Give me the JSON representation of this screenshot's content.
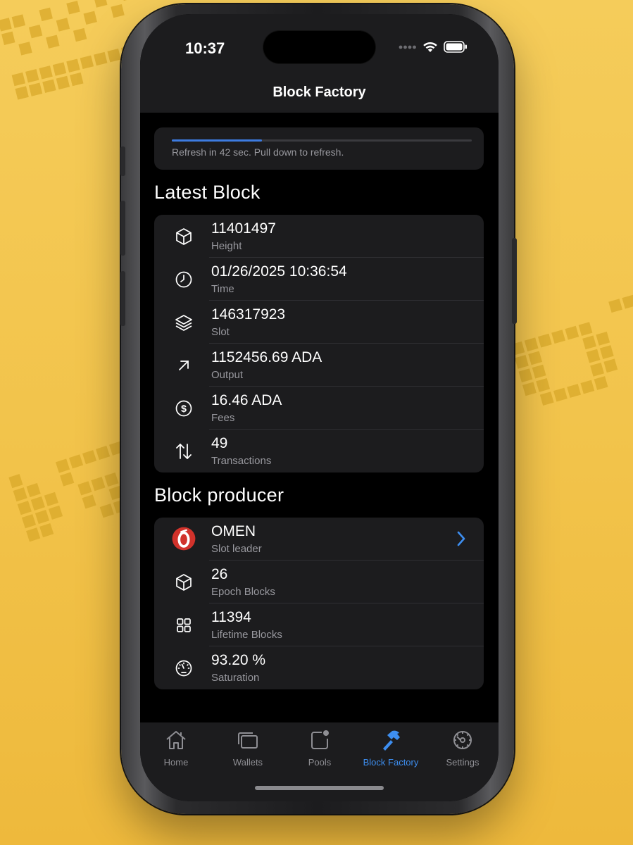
{
  "status": {
    "time": "10:37"
  },
  "nav": {
    "title": "Block Factory"
  },
  "refresh": {
    "text": "Refresh in 42 sec. Pull down to refresh.",
    "progress": 0.3
  },
  "latest_block": {
    "title": "Latest Block",
    "rows": [
      {
        "icon": "cube-icon",
        "value": "11401497",
        "label": "Height"
      },
      {
        "icon": "clock-icon",
        "value": "01/26/2025 10:36:54",
        "label": "Time"
      },
      {
        "icon": "layers-icon",
        "value": "146317923",
        "label": "Slot"
      },
      {
        "icon": "arrow-up-right-icon",
        "value": "1152456.69 ADA",
        "label": "Output"
      },
      {
        "icon": "dollar-circle-icon",
        "value": "16.46 ADA",
        "label": "Fees"
      },
      {
        "icon": "arrows-up-down-icon",
        "value": "49",
        "label": "Transactions"
      }
    ]
  },
  "block_producer": {
    "title": "Block producer",
    "rows": [
      {
        "icon": "pool-logo-icon",
        "value": "OMEN",
        "label": "Slot leader"
      },
      {
        "icon": "cube-icon",
        "value": "26",
        "label": "Epoch Blocks"
      },
      {
        "icon": "grid-icon",
        "value": "11394",
        "label": "Lifetime Blocks"
      },
      {
        "icon": "gauge-icon",
        "value": "93.20 %",
        "label": "Saturation"
      }
    ]
  },
  "tabs": [
    {
      "icon": "house-icon",
      "label": "Home"
    },
    {
      "icon": "wallets-icon",
      "label": "Wallets"
    },
    {
      "icon": "pools-icon",
      "label": "Pools"
    },
    {
      "icon": "hammer-icon",
      "label": "Block Factory",
      "active": true
    },
    {
      "icon": "gear-icon",
      "label": "Settings"
    }
  ],
  "colors": {
    "accent": "#3d8ef0",
    "background": "#f2c34a",
    "card": "#1c1c1e"
  }
}
